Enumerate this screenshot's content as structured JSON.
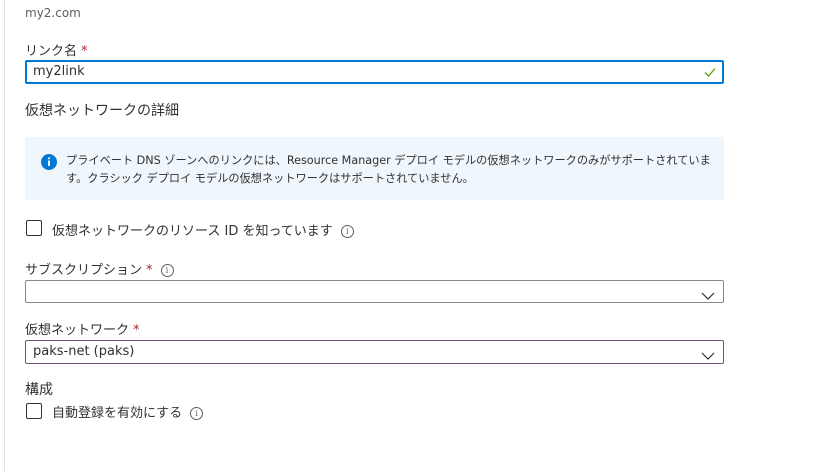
{
  "zone": {
    "name": "my2.com"
  },
  "link_name": {
    "label": "リンク名",
    "value": "my2link"
  },
  "required_marker": "*",
  "vnet_details": {
    "heading": "仮想ネットワークの詳細"
  },
  "info_banner": {
    "text": "プライベート DNS ゾーンへのリンクには、Resource Manager デプロイ モデルの仮想ネットワークのみがサポートされています。クラシック デプロイ モデルの仮想ネットワークはサポートされていません。"
  },
  "know_resource_id": {
    "label": "仮想ネットワークのリソース ID を知っています",
    "checked": false
  },
  "subscription": {
    "label": "サブスクリプション",
    "value": ""
  },
  "virtual_network": {
    "label": "仮想ネットワーク",
    "value": "paks-net (paks)"
  },
  "configuration": {
    "heading": "構成"
  },
  "auto_registration": {
    "label": "自動登録を有効にする",
    "checked": false
  },
  "info_glyph": "i",
  "colors": {
    "accent": "#0078d4",
    "required": "#a4262c",
    "valid": "#57a300",
    "banner_bg": "#eff6fc"
  },
  "icons": [
    "check-icon",
    "info-icon",
    "chevron-down-icon"
  ]
}
